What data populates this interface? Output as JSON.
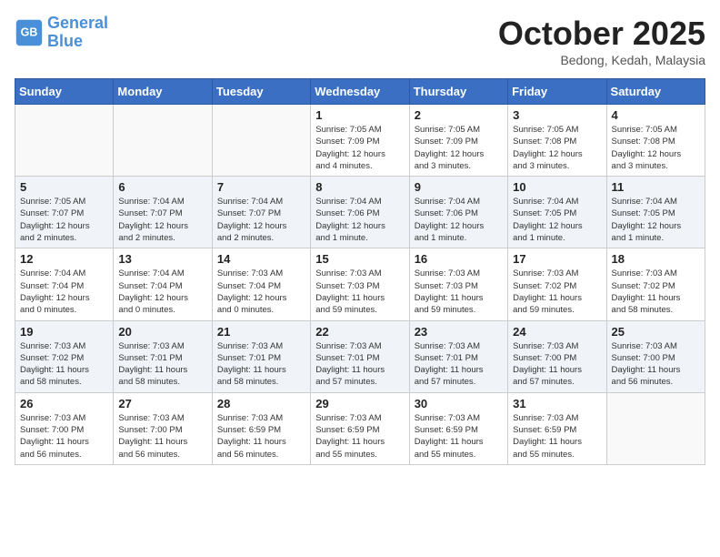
{
  "header": {
    "logo": {
      "line1": "General",
      "line2": "Blue"
    },
    "title": "October 2025",
    "subtitle": "Bedong, Kedah, Malaysia"
  },
  "days_of_week": [
    "Sunday",
    "Monday",
    "Tuesday",
    "Wednesday",
    "Thursday",
    "Friday",
    "Saturday"
  ],
  "weeks": [
    [
      {
        "day": "",
        "info": ""
      },
      {
        "day": "",
        "info": ""
      },
      {
        "day": "",
        "info": ""
      },
      {
        "day": "1",
        "info": "Sunrise: 7:05 AM\nSunset: 7:09 PM\nDaylight: 12 hours\nand 4 minutes."
      },
      {
        "day": "2",
        "info": "Sunrise: 7:05 AM\nSunset: 7:09 PM\nDaylight: 12 hours\nand 3 minutes."
      },
      {
        "day": "3",
        "info": "Sunrise: 7:05 AM\nSunset: 7:08 PM\nDaylight: 12 hours\nand 3 minutes."
      },
      {
        "day": "4",
        "info": "Sunrise: 7:05 AM\nSunset: 7:08 PM\nDaylight: 12 hours\nand 3 minutes."
      }
    ],
    [
      {
        "day": "5",
        "info": "Sunrise: 7:05 AM\nSunset: 7:07 PM\nDaylight: 12 hours\nand 2 minutes."
      },
      {
        "day": "6",
        "info": "Sunrise: 7:04 AM\nSunset: 7:07 PM\nDaylight: 12 hours\nand 2 minutes."
      },
      {
        "day": "7",
        "info": "Sunrise: 7:04 AM\nSunset: 7:07 PM\nDaylight: 12 hours\nand 2 minutes."
      },
      {
        "day": "8",
        "info": "Sunrise: 7:04 AM\nSunset: 7:06 PM\nDaylight: 12 hours\nand 1 minute."
      },
      {
        "day": "9",
        "info": "Sunrise: 7:04 AM\nSunset: 7:06 PM\nDaylight: 12 hours\nand 1 minute."
      },
      {
        "day": "10",
        "info": "Sunrise: 7:04 AM\nSunset: 7:05 PM\nDaylight: 12 hours\nand 1 minute."
      },
      {
        "day": "11",
        "info": "Sunrise: 7:04 AM\nSunset: 7:05 PM\nDaylight: 12 hours\nand 1 minute."
      }
    ],
    [
      {
        "day": "12",
        "info": "Sunrise: 7:04 AM\nSunset: 7:04 PM\nDaylight: 12 hours\nand 0 minutes."
      },
      {
        "day": "13",
        "info": "Sunrise: 7:04 AM\nSunset: 7:04 PM\nDaylight: 12 hours\nand 0 minutes."
      },
      {
        "day": "14",
        "info": "Sunrise: 7:03 AM\nSunset: 7:04 PM\nDaylight: 12 hours\nand 0 minutes."
      },
      {
        "day": "15",
        "info": "Sunrise: 7:03 AM\nSunset: 7:03 PM\nDaylight: 11 hours\nand 59 minutes."
      },
      {
        "day": "16",
        "info": "Sunrise: 7:03 AM\nSunset: 7:03 PM\nDaylight: 11 hours\nand 59 minutes."
      },
      {
        "day": "17",
        "info": "Sunrise: 7:03 AM\nSunset: 7:02 PM\nDaylight: 11 hours\nand 59 minutes."
      },
      {
        "day": "18",
        "info": "Sunrise: 7:03 AM\nSunset: 7:02 PM\nDaylight: 11 hours\nand 58 minutes."
      }
    ],
    [
      {
        "day": "19",
        "info": "Sunrise: 7:03 AM\nSunset: 7:02 PM\nDaylight: 11 hours\nand 58 minutes."
      },
      {
        "day": "20",
        "info": "Sunrise: 7:03 AM\nSunset: 7:01 PM\nDaylight: 11 hours\nand 58 minutes."
      },
      {
        "day": "21",
        "info": "Sunrise: 7:03 AM\nSunset: 7:01 PM\nDaylight: 11 hours\nand 58 minutes."
      },
      {
        "day": "22",
        "info": "Sunrise: 7:03 AM\nSunset: 7:01 PM\nDaylight: 11 hours\nand 57 minutes."
      },
      {
        "day": "23",
        "info": "Sunrise: 7:03 AM\nSunset: 7:01 PM\nDaylight: 11 hours\nand 57 minutes."
      },
      {
        "day": "24",
        "info": "Sunrise: 7:03 AM\nSunset: 7:00 PM\nDaylight: 11 hours\nand 57 minutes."
      },
      {
        "day": "25",
        "info": "Sunrise: 7:03 AM\nSunset: 7:00 PM\nDaylight: 11 hours\nand 56 minutes."
      }
    ],
    [
      {
        "day": "26",
        "info": "Sunrise: 7:03 AM\nSunset: 7:00 PM\nDaylight: 11 hours\nand 56 minutes."
      },
      {
        "day": "27",
        "info": "Sunrise: 7:03 AM\nSunset: 7:00 PM\nDaylight: 11 hours\nand 56 minutes."
      },
      {
        "day": "28",
        "info": "Sunrise: 7:03 AM\nSunset: 6:59 PM\nDaylight: 11 hours\nand 56 minutes."
      },
      {
        "day": "29",
        "info": "Sunrise: 7:03 AM\nSunset: 6:59 PM\nDaylight: 11 hours\nand 55 minutes."
      },
      {
        "day": "30",
        "info": "Sunrise: 7:03 AM\nSunset: 6:59 PM\nDaylight: 11 hours\nand 55 minutes."
      },
      {
        "day": "31",
        "info": "Sunrise: 7:03 AM\nSunset: 6:59 PM\nDaylight: 11 hours\nand 55 minutes."
      },
      {
        "day": "",
        "info": ""
      }
    ]
  ]
}
